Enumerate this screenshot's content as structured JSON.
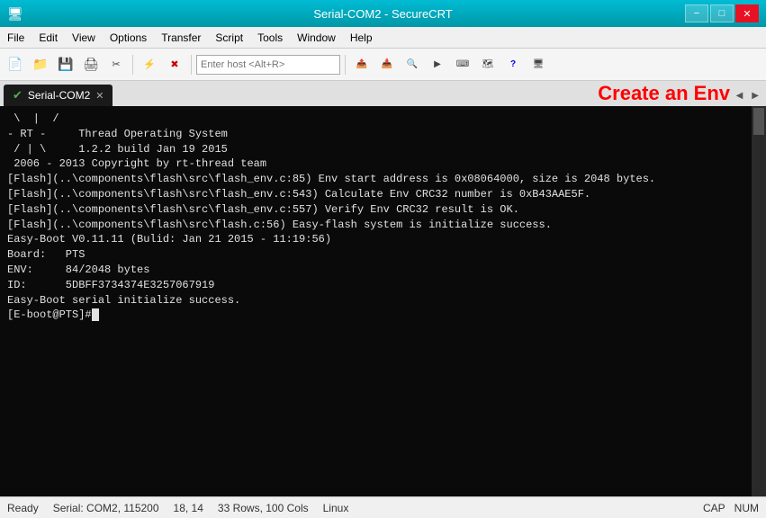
{
  "titlebar": {
    "title": "Serial-COM2 - SecureCRT",
    "icon": "🖥",
    "minimize": "−",
    "maximize": "□",
    "close": "✕"
  },
  "menubar": {
    "items": [
      "File",
      "Edit",
      "View",
      "Options",
      "Transfer",
      "Script",
      "Tools",
      "Window",
      "Help"
    ]
  },
  "toolbar": {
    "host_placeholder": "Enter host <Alt+R>"
  },
  "tab": {
    "name": "Serial-COM2",
    "checkmark": "✔"
  },
  "create_env_label": "Create an Env",
  "terminal": {
    "lines": [
      " \\  |  /",
      "- RT -     Thread Operating System",
      " / | \\     1.2.2 build Jan 19 2015",
      " 2006 - 2013 Copyright by rt-thread team",
      "[Flash](..\\components\\flash\\src\\flash_env.c:85) Env start address is 0x08064000, size is 2048 bytes.",
      "[Flash](..\\components\\flash\\src\\flash_env.c:543) Calculate Env CRC32 number is 0xB43AAE5F.",
      "[Flash](..\\components\\flash\\src\\flash_env.c:557) Verify Env CRC32 result is OK.",
      "[Flash](..\\components\\flash\\src\\flash.c:56) Easy-flash system is initialize success.",
      "",
      "Easy-Boot V0.11.11 (Bulid: Jan 21 2015 - 11:19:56)",
      "Board:   PTS",
      "ENV:     84/2048 bytes",
      "ID:      5DBFF3734374E3257067919",
      "",
      "Easy-Boot serial initialize success.",
      "[E-boot@PTS]#"
    ],
    "cursor_at_end": true
  },
  "statusbar": {
    "ready": "Ready",
    "serial": "Serial: COM2, 115200",
    "row": "18, 14",
    "rows_cols": "33 Rows, 100 Cols",
    "os": "Linux",
    "cap": "CAP",
    "num": "NUM"
  }
}
